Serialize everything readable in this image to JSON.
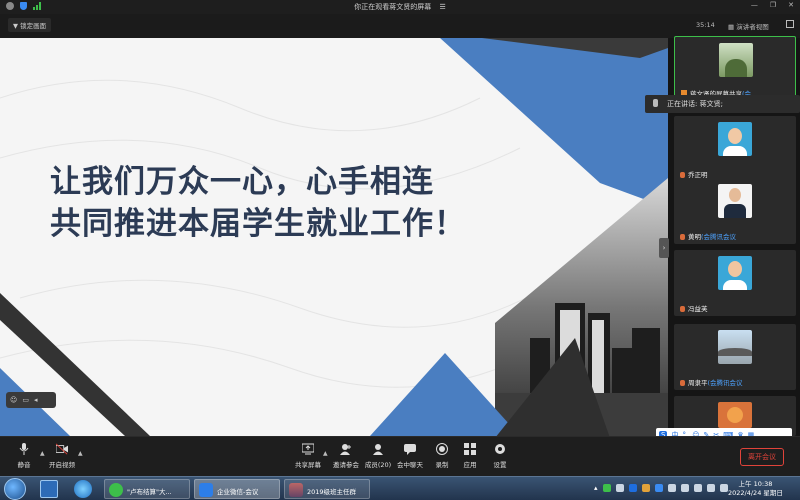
{
  "window": {
    "title": "你正在观看蒋文贤的屏幕",
    "menu_glyph": "☰"
  },
  "topbar": {
    "lock_label": "锁定画面",
    "timer": "35:14",
    "view_label": "演讲者视图"
  },
  "slide": {
    "line1": "让我们万众一心，心手相连",
    "line2": "共同推进本届学生就业工作！"
  },
  "speaking": {
    "label": "正在讲话: 蒋文贤;"
  },
  "participants": [
    {
      "name": "蒋文贤的屏幕共享",
      "tag": "(会...",
      "muted": true,
      "photo": "trees"
    },
    {
      "name": "乔正明",
      "tag": "",
      "muted": false,
      "photo": "glasses"
    },
    {
      "name": "黄明",
      "tag": "(会腾讯会议",
      "muted": false,
      "photo": "suit"
    },
    {
      "name": "冯益芙",
      "tag": "",
      "muted": false,
      "photo": "face"
    },
    {
      "name": "周隶平",
      "tag": "(会腾讯会议",
      "muted": false,
      "photo": "bridge"
    },
    {
      "name": "",
      "tag": "",
      "muted": false,
      "photo": "orange"
    }
  ],
  "toolbar": {
    "mute": "静音",
    "video": "开启视频",
    "share": "共享屏幕",
    "invite": "邀请参会",
    "members": "成员(20)",
    "chat": "会中聊天",
    "record": "录制",
    "apps": "应用",
    "settings": "设置",
    "leave": "离开会议"
  },
  "ime": {
    "logo": "S",
    "mode": "中"
  },
  "taskbar": {
    "tasks": [
      "\"卢布结算\"大...",
      "企业微信-会议",
      "2019级班主任群"
    ],
    "time": "上午 10:38",
    "date": "2022/4/24 星期日"
  },
  "colors": {
    "accent_blue": "#4a7ec1",
    "navy_text": "#2c3b55",
    "leave_red": "#e0433a"
  }
}
